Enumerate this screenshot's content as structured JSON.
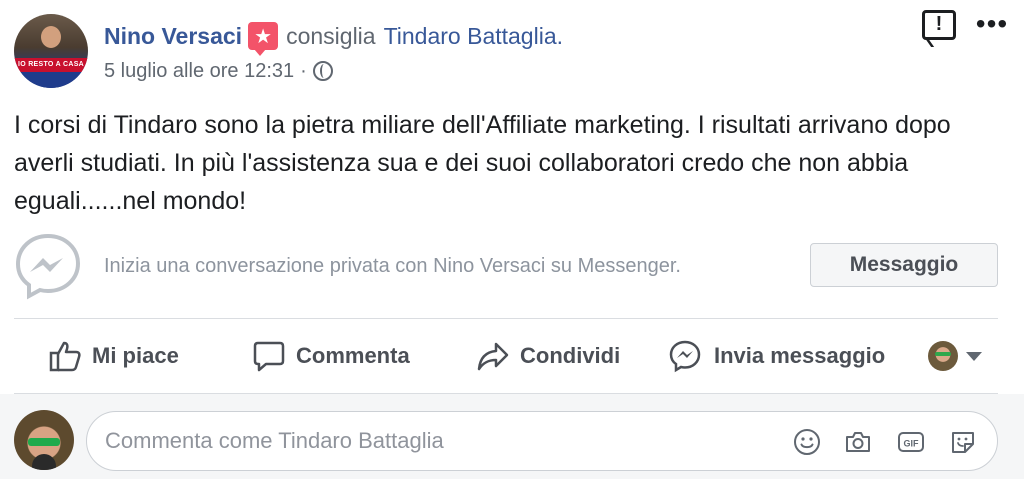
{
  "post": {
    "author": "Nino Versaci",
    "verb": "consiglia",
    "target": "Tindaro Battaglia.",
    "timestamp": "5 luglio alle ore 12:31",
    "separator": "·",
    "avatar_banner": "IO RESTO A CASA",
    "text": "I corsi di Tindaro sono la pietra miliare dell'Affiliate marketing. I risultati arrivano dopo averli studiati. In più l'assistenza sua e dei suoi collaboratori credo che non abbia eguali......nel mondo!",
    "header_icons": [
      "report-icon",
      "more-icon"
    ]
  },
  "messenger_cta": {
    "text": "Inizia una conversazione privata con Nino Versaci su Messenger.",
    "button_label": "Messaggio",
    "icon": "messenger-icon"
  },
  "actions": [
    {
      "label": "Mi piace",
      "icon": "thumbs-up-icon"
    },
    {
      "label": "Commenta",
      "icon": "comment-icon"
    },
    {
      "label": "Condividi",
      "icon": "share-icon"
    },
    {
      "label": "Invia messaggio",
      "icon": "messenger-outline-icon"
    }
  ],
  "composer": {
    "placeholder": "Commenta come Tindaro Battaglia",
    "value": "",
    "icons": [
      "emoji-icon",
      "camera-icon",
      "gif-icon",
      "sticker-icon"
    ]
  },
  "colors": {
    "link": "#385898",
    "secondary_text": "#606770",
    "badge": "#f35369",
    "divider": "#dadde1"
  }
}
